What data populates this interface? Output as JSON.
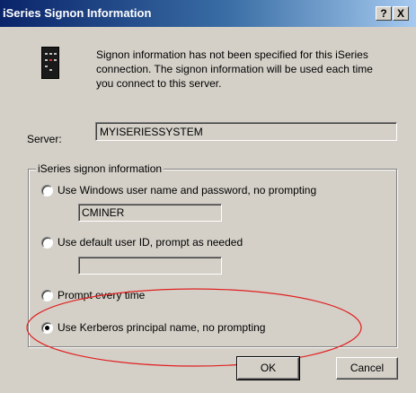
{
  "window": {
    "title": "iSeries Signon Information",
    "help_glyph": "?",
    "close_glyph": "X"
  },
  "intro": "Signon information has not been specified for this iSeries connection.  The signon information will be used each time you connect to this server.",
  "server": {
    "label": "Server:",
    "value": "MYISERIESSYSTEM"
  },
  "group": {
    "legend": "iSeries signon information",
    "options": [
      {
        "label": "Use Windows user name and password, no prompting",
        "selected": false,
        "field_value": "CMINER"
      },
      {
        "label": "Use default user ID, prompt as needed",
        "selected": false,
        "field_value": ""
      },
      {
        "label": "Prompt every time",
        "selected": false
      },
      {
        "label": "Use Kerberos principal name, no prompting",
        "selected": true
      }
    ]
  },
  "buttons": {
    "ok": "OK",
    "cancel": "Cancel"
  },
  "colors": {
    "title_start": "#0a246a",
    "face": "#d4d0c8",
    "highlight_ellipse": "#e02020"
  }
}
